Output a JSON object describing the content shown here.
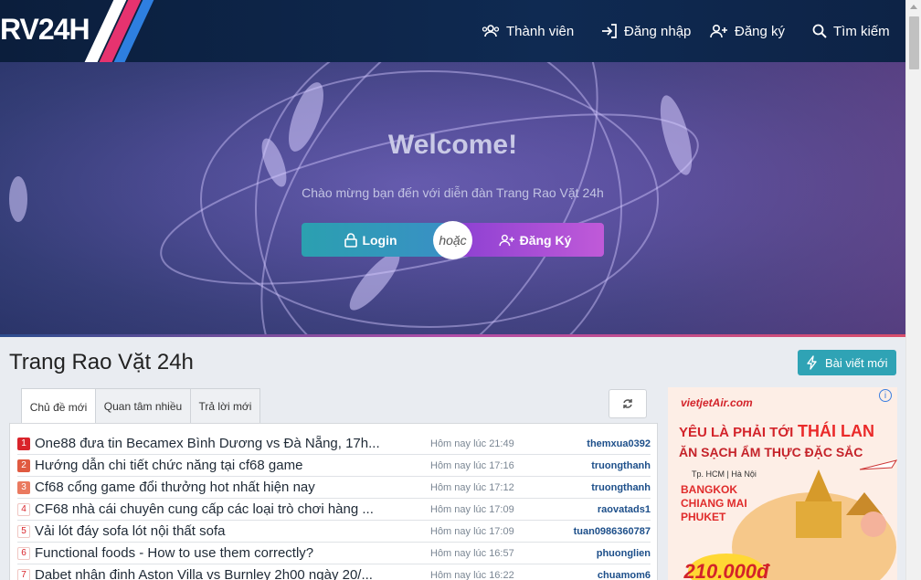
{
  "header": {
    "logo": "RV24H",
    "nav": {
      "members": "Thành viên",
      "login": "Đăng nhập",
      "register": "Đăng ký",
      "search": "Tìm kiếm"
    }
  },
  "hero": {
    "welcome": "Welcome!",
    "subtitle": "Chào mừng bạn đến với diễn đàn Trang Rao Vặt 24h",
    "login_label": "Login",
    "or_label": "hoặc",
    "register_label": "Đăng Ký"
  },
  "main": {
    "title": "Trang Rao Vặt 24h",
    "new_post_label": "Bài viết mới",
    "tabs": [
      {
        "label": "Chủ đề mới"
      },
      {
        "label": "Quan tâm nhiều"
      },
      {
        "label": "Trả lời mới"
      }
    ],
    "threads": [
      {
        "num": "1",
        "title": "One88 đưa tin Becamex Bình Dương vs Đà Nẵng, 17h...",
        "time": "Hôm nay lúc 21:49",
        "user": "themxua0392"
      },
      {
        "num": "2",
        "title": "Hướng dẫn chi tiết chức năng tại cf68 game",
        "time": "Hôm nay lúc 17:16",
        "user": "truongthanh"
      },
      {
        "num": "3",
        "title": "Cf68 cổng game đổi thưởng hot nhất hiện nay",
        "time": "Hôm nay lúc 17:12",
        "user": "truongthanh"
      },
      {
        "num": "4",
        "title": "CF68 nhà cái chuyên cung cấp các loại trò chơi hàng ...",
        "time": "Hôm nay lúc 17:09",
        "user": "raovatads1"
      },
      {
        "num": "5",
        "title": "Vải lót đáy sofa lót nội thất sofa",
        "time": "Hôm nay lúc 17:09",
        "user": "tuan0986360787"
      },
      {
        "num": "6",
        "title": "Functional foods - How to use them correctly?",
        "time": "Hôm nay lúc 16:57",
        "user": "phuonglien"
      },
      {
        "num": "7",
        "title": "Dabet nhận định Aston Villa vs Burnley 2h00 ngày 20/...",
        "time": "Hôm nay lúc 16:22",
        "user": "chuamom6"
      }
    ]
  },
  "ad": {
    "brand": "vietjetAir.com",
    "info": "i",
    "line1": "YÊU LÀ PHẢI TỚI",
    "line1_highlight": "THÁI LAN",
    "line2": "ĂN SẠCH ẨM THỰC ĐẶC SẮC",
    "route": "Tp. HCM | Hà Nội",
    "cities": [
      "BANGKOK",
      "CHIANG MAI",
      "PHUKET"
    ],
    "price": "210.000đ"
  }
}
